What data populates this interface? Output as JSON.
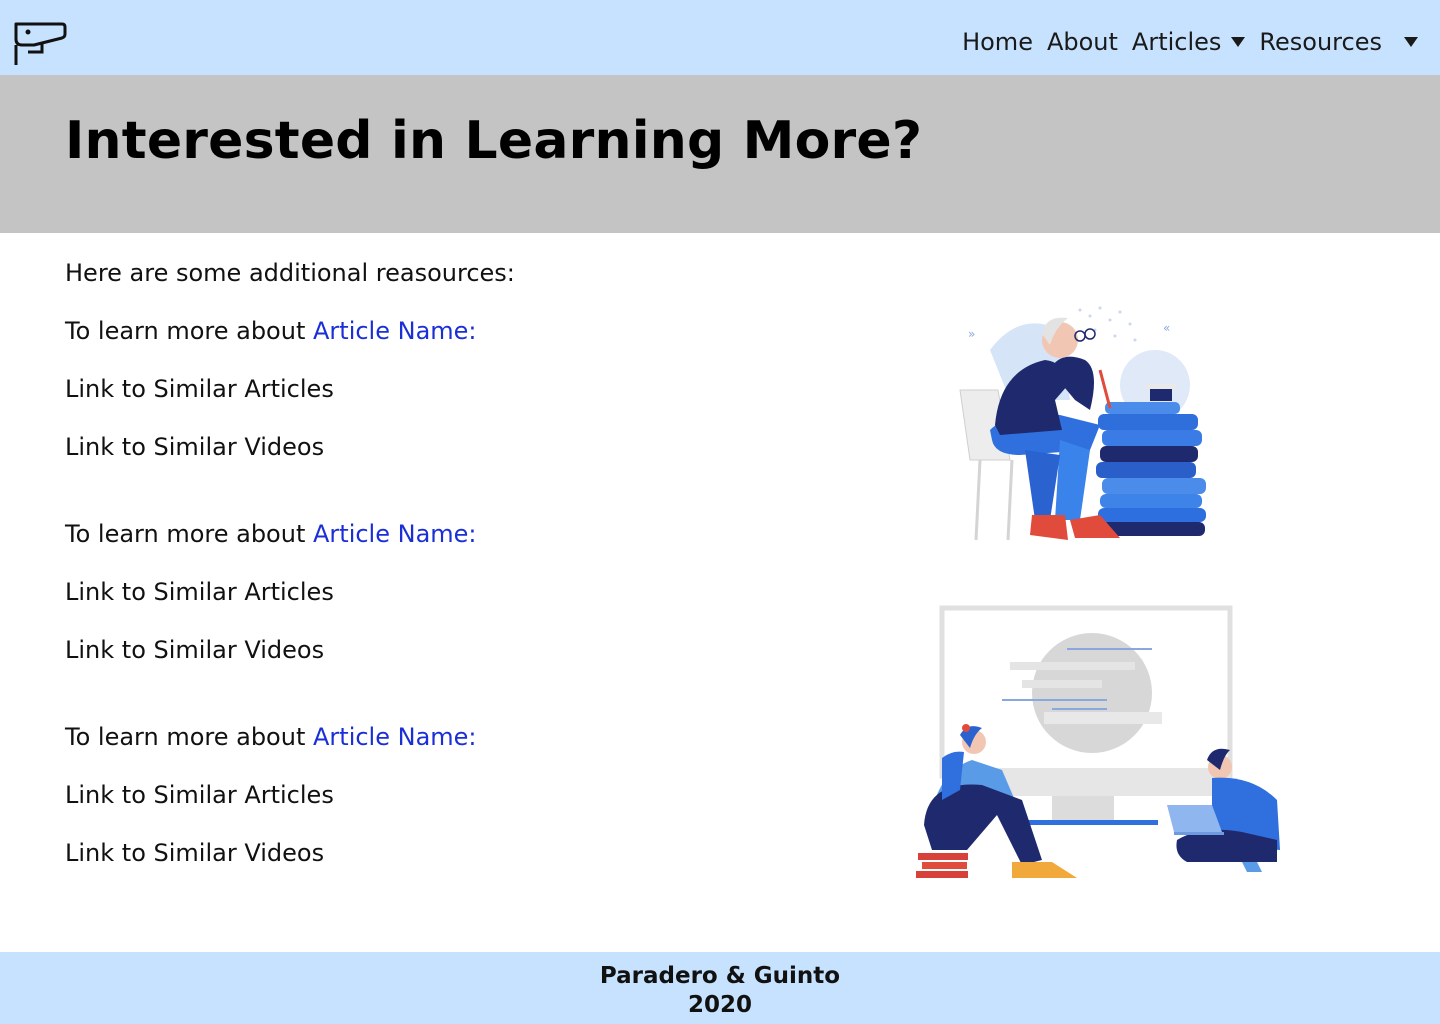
{
  "header": {
    "logo_icon": "security-camera-icon",
    "nav": {
      "home": "Home",
      "about": "About",
      "articles": "Articles",
      "resources": "Resources"
    }
  },
  "hero": {
    "title": "Interested in Learning More?"
  },
  "main": {
    "intro": "Here are some additional reasources:",
    "groups": [
      {
        "prefix": "To learn more about ",
        "article_link": "Article Name:",
        "articles_link": "Link to Similar Articles",
        "videos_link": "Link to Similar Videos"
      },
      {
        "prefix": "To learn more about ",
        "article_link": "Article Name:",
        "articles_link": "Link to Similar Articles",
        "videos_link": "Link to Similar Videos"
      },
      {
        "prefix": "To learn more about ",
        "article_link": "Article Name:",
        "articles_link": "Link to Similar Articles",
        "videos_link": "Link to Similar Videos"
      }
    ]
  },
  "illustrations": {
    "first": "person-studying-books-illustration",
    "second": "people-with-monitor-illustration"
  },
  "footer": {
    "line1": "Paradero & Guinto",
    "line2": "2020"
  },
  "colors": {
    "nav_bg": "#c7e2fe",
    "hero_bg": "#c4c4c4",
    "link": "#1a2fd6"
  }
}
